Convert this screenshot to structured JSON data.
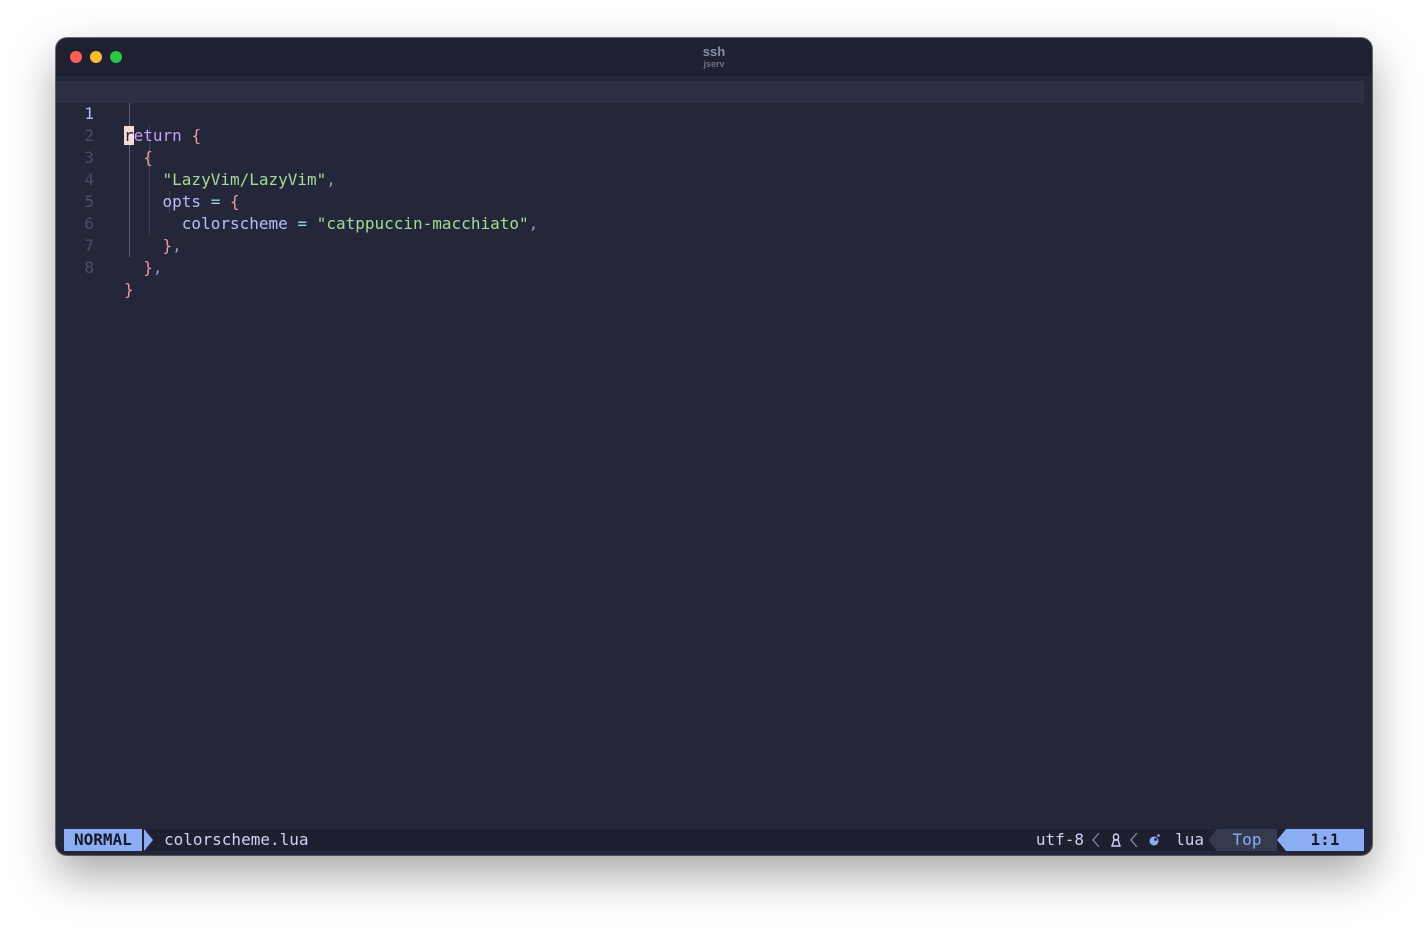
{
  "window": {
    "title": "ssh",
    "subtitle": "jserv"
  },
  "editor": {
    "current_line": 1,
    "lines": [
      {
        "num": "1"
      },
      {
        "num": "2"
      },
      {
        "num": "3"
      },
      {
        "num": "4"
      },
      {
        "num": "5"
      },
      {
        "num": "6"
      },
      {
        "num": "7"
      },
      {
        "num": "8"
      }
    ],
    "tokens": {
      "l1_cursor": "r",
      "l1_kw": "eturn",
      "l1_brace": "{",
      "l2_brace": "{",
      "l3_str": "\"LazyVim/LazyVim\"",
      "l3_comma": ",",
      "l4_key": "opts",
      "l4_eq": "=",
      "l4_brace": "{",
      "l5_key": "colorscheme",
      "l5_eq": "=",
      "l5_str": "\"catppuccin-macchiato\"",
      "l5_comma": ",",
      "l6_brace": "}",
      "l6_comma": ",",
      "l7_brace": "}",
      "l7_comma": ",",
      "l8_brace": "}"
    }
  },
  "statusline": {
    "mode": "NORMAL",
    "filename": "colorscheme.lua",
    "encoding": "utf-8",
    "fileformat_icon": "linux-tux-icon",
    "filetype_icon": "lua-moon-icon",
    "filetype": "lua",
    "progress": "Top",
    "location": "1:1"
  },
  "colors": {
    "background": "#24273a",
    "mode_accent": "#8aadf4",
    "keyword": "#c6a0f6",
    "string": "#a6da95",
    "brace": "#ee99a0",
    "property": "#b7bdf8",
    "operator": "#91d7e3"
  }
}
